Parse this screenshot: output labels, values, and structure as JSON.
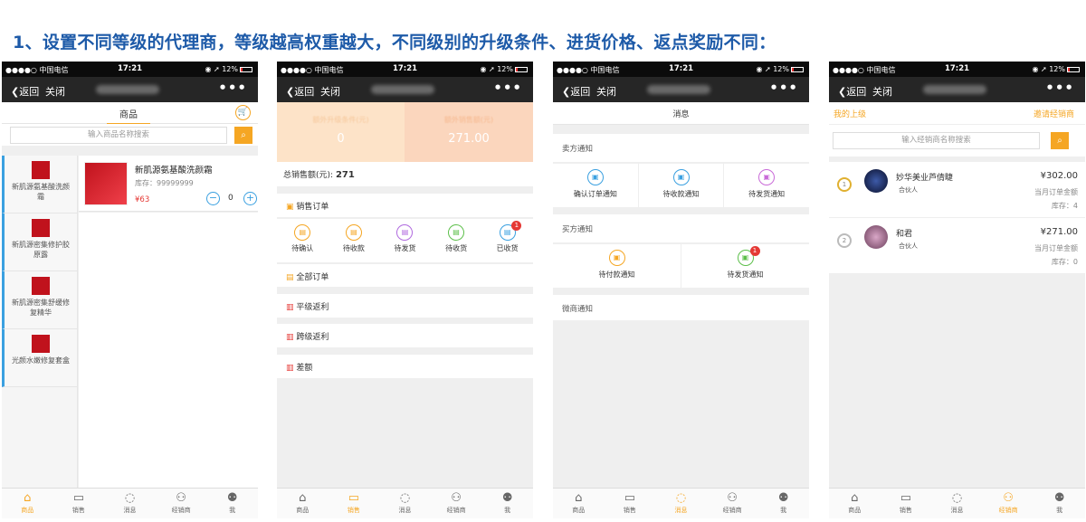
{
  "heading": "1、设置不同等级的代理商，等级越高权重越大，不同级别的升级条件、进货价格、返点奖励不同：",
  "status": {
    "carrier": "●●●●○ 中国电信 ",
    "time": "17:21",
    "battery": "12%"
  },
  "nav": {
    "back": "返回",
    "close": "关闭",
    "more": "•••"
  },
  "tabs": [
    "商品",
    "销售",
    "消息",
    "经销商",
    "我"
  ],
  "phone1": {
    "tab_label": "商品",
    "search_placeholder": "输入商品名称搜索",
    "categories": [
      "新肌源氨基酸洗颜霜",
      "新肌源密集修护胶原露",
      "新肌源密集舒缓修复精华",
      "光颜水嫩修复套盒"
    ],
    "product": {
      "name": "新肌源氨基酸洗颜霜",
      "stock": "库存：99999999",
      "price": "¥63",
      "qty": "0"
    }
  },
  "phone2": {
    "stat_left_label": "额外升级条件(元)",
    "stat_left_value": "0",
    "stat_right_label": "额外销售额(元)",
    "stat_right_value": "271.00",
    "total_label": "总销售额(元):",
    "total_value": "271",
    "sales_order": "销售订单",
    "statuses": [
      "待确认",
      "待收款",
      "待发货",
      "待收货",
      "已收货"
    ],
    "badge": "1",
    "all_orders": "全部订单",
    "rebate1": "平级返利",
    "rebate2": "跨级返利",
    "diff": "差额"
  },
  "phone3": {
    "title": "消息",
    "seller_notice": "卖方通知",
    "seller_items": [
      "确认订单通知",
      "待收款通知",
      "待发货通知"
    ],
    "buyer_notice": "买方通知",
    "buyer_items": [
      "待付款通知",
      "待发货通知"
    ],
    "badge": "1",
    "micro_notice": "微商通知"
  },
  "phone4": {
    "my_superior": "我的上级",
    "invite": "邀请经销商",
    "search_placeholder": "输入经销商名称搜索",
    "dealers": [
      {
        "name": "妙华美业芦倩睫",
        "role": "合伙人",
        "amount": "¥302.00",
        "amount_label": "当月订单金额",
        "stock": "库存：4",
        "rank": "1"
      },
      {
        "name": "和君",
        "role": "合伙人",
        "amount": "¥271.00",
        "amount_label": "当月订单金额",
        "stock": "库存：0",
        "rank": "2"
      }
    ]
  },
  "colors": {
    "accent": "#f5a623",
    "title_blue": "#1d5aa8",
    "badge_red": "#e53935"
  }
}
